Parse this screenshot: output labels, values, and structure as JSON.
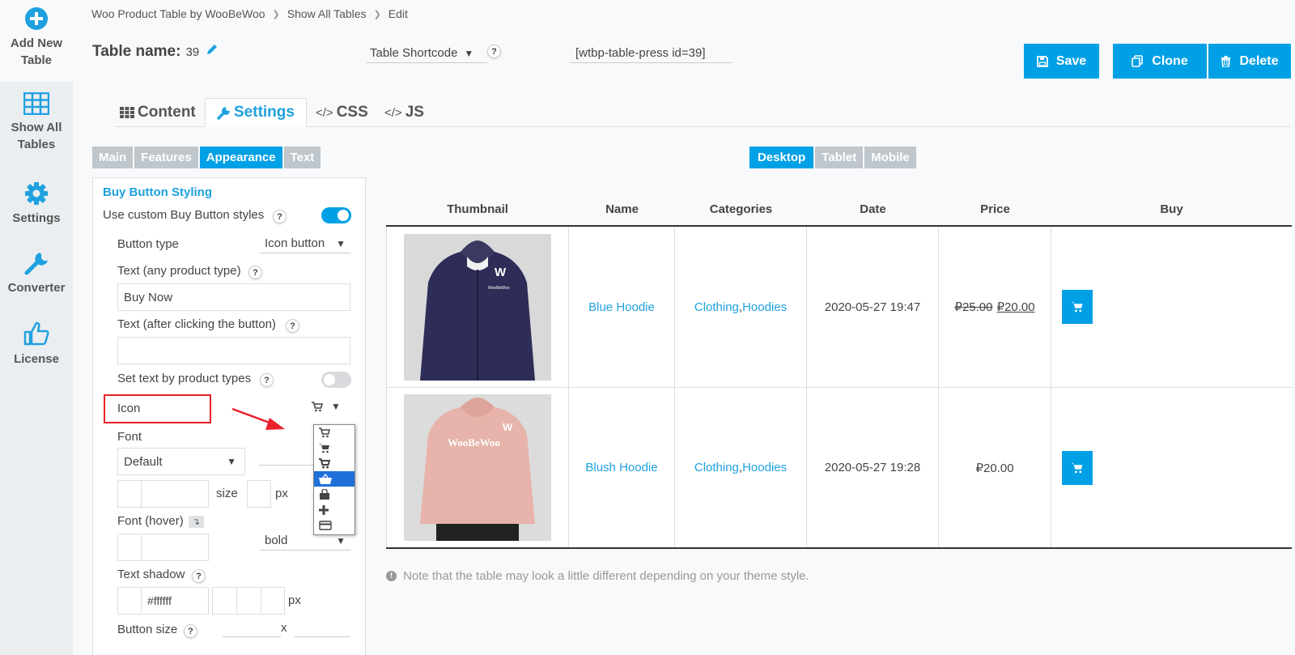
{
  "sidebar": {
    "items": [
      {
        "label": "Add New Table",
        "icon": "plus-circle-icon"
      },
      {
        "label": "Show All Tables",
        "icon": "table-grid-icon"
      },
      {
        "label": "Settings",
        "icon": "gear-icon"
      },
      {
        "label": "Converter",
        "icon": "wrench-icon"
      },
      {
        "label": "License",
        "icon": "thumbs-up-icon"
      }
    ]
  },
  "breadcrumb": [
    "Woo Product Table by WooBeWoo",
    "Show All Tables",
    "Edit"
  ],
  "header": {
    "table_name_label": "Table name:",
    "table_name_value": "39",
    "shortcode_select": "Table Shortcode",
    "shortcode_value": "[wtbp-table-press id=39]",
    "save": "Save",
    "clone": "Clone",
    "delete": "Delete"
  },
  "main_tabs": [
    "Content",
    "Settings",
    "CSS",
    "JS"
  ],
  "sub_tabs": [
    "Main",
    "Features",
    "Appearance",
    "Text"
  ],
  "device_tabs": [
    "Desktop",
    "Tablet",
    "Mobile"
  ],
  "panel": {
    "title": "Buy Button Styling",
    "use_custom": "Use custom Buy Button styles",
    "button_type_label": "Button type",
    "button_type_value": "Icon button",
    "text_any_label": "Text (any product type)",
    "text_any_value": "Buy Now",
    "text_after_label": "Text (after clicking the button)",
    "text_after_value": "",
    "set_text_label": "Set text by product types",
    "icon_label": "Icon",
    "font_label": "Font",
    "font_value": "Default",
    "size_label": "size",
    "px": "px",
    "font_hover_label": "Font (hover)",
    "font_hover_weight": "bold",
    "text_shadow_label": "Text shadow",
    "text_shadow_color": "#ffffff",
    "button_size_label": "Button size",
    "x": "x",
    "help": "?",
    "copy_icon": "↴"
  },
  "icon_dropdown": [
    "cart-1-icon",
    "cart-2-icon",
    "cart-3-icon",
    "basket-icon",
    "bag-icon",
    "plus-icon",
    "credit-card-icon"
  ],
  "preview": {
    "columns": [
      "Thumbnail",
      "Name",
      "Categories",
      "Date",
      "Price",
      "Buy"
    ],
    "rows": [
      {
        "name": "Blue Hoodie",
        "cat1": "Clothing",
        "cat2": "Hoodies",
        "date": "2020-05-27 19:47",
        "old_price": "₽25.00",
        "price": "₽20.00",
        "shirt_color": "#2e2d57",
        "brand": "WooBeWoo"
      },
      {
        "name": "Blush Hoodie",
        "cat1": "Clothing",
        "cat2": "Hoodies",
        "date": "2020-05-27 19:28",
        "old_price": "",
        "price": "₽20.00",
        "shirt_color": "#e7b3aa",
        "brand": "WooBeWoo"
      }
    ],
    "sep": ", "
  },
  "note": "Note that the table may look a little different depending on your theme style.",
  "colors": {
    "accent": "#00a0e6",
    "link": "#1fa1e0",
    "annotation": "#e8212b"
  }
}
